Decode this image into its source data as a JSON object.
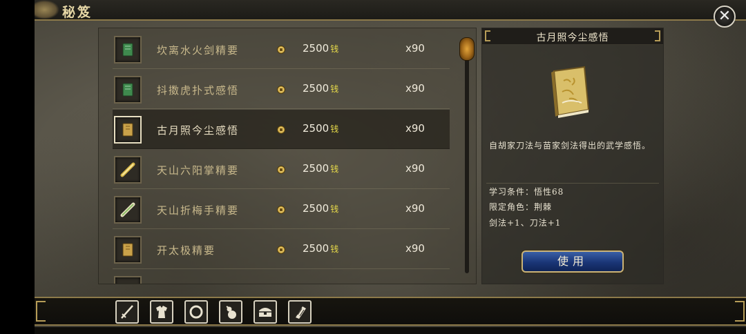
{
  "window": {
    "title": "秘笈"
  },
  "close_icon": "close-icon",
  "items": [
    {
      "name": "坎离水火剑精要",
      "price": "2500",
      "currency": "钱",
      "qty": "x90",
      "icon": "green-book-icon",
      "color": "#3f8a4e"
    },
    {
      "name": "抖擞虎扑式感悟",
      "price": "2500",
      "currency": "钱",
      "qty": "x90",
      "icon": "green-book-icon",
      "color": "#3f8a4e"
    },
    {
      "name": "古月照今尘感悟",
      "price": "2500",
      "currency": "钱",
      "qty": "x90",
      "icon": "yellow-book-icon",
      "color": "#caa24a",
      "selected": true
    },
    {
      "name": "天山六阳掌精要",
      "price": "2500",
      "currency": "钱",
      "qty": "x90",
      "icon": "yellow-scroll-icon",
      "color": "#d8b84a"
    },
    {
      "name": "天山折梅手精要",
      "price": "2500",
      "currency": "钱",
      "qty": "x90",
      "icon": "green-scroll-icon",
      "color": "#8fbf6a"
    },
    {
      "name": "开太极精要",
      "price": "2500",
      "currency": "钱",
      "qty": "x90",
      "icon": "yellow-book-icon",
      "color": "#caa24a"
    }
  ],
  "detail": {
    "title": "古月照今尘感悟",
    "description": "自胡家刀法与苗家剑法得出的武学感悟。",
    "requirement": "学习条件：悟性68",
    "role": "限定角色：荆棘",
    "bonus": "剑法+1、刀法+1",
    "use_label": "使用"
  },
  "tabs": [
    {
      "name": "weapon-tab",
      "icon": "sword-icon"
    },
    {
      "name": "armor-tab",
      "icon": "robe-icon"
    },
    {
      "name": "accessory-tab",
      "icon": "ring-icon"
    },
    {
      "name": "consumable-tab",
      "icon": "gourd-icon"
    },
    {
      "name": "misc-tab",
      "icon": "chest-icon"
    },
    {
      "name": "manual-tab",
      "icon": "scroll-icon"
    }
  ],
  "colors": {
    "accent_gold": "#b79d58",
    "button_blue": "#1a3576",
    "price_currency": "#e6d94a"
  }
}
